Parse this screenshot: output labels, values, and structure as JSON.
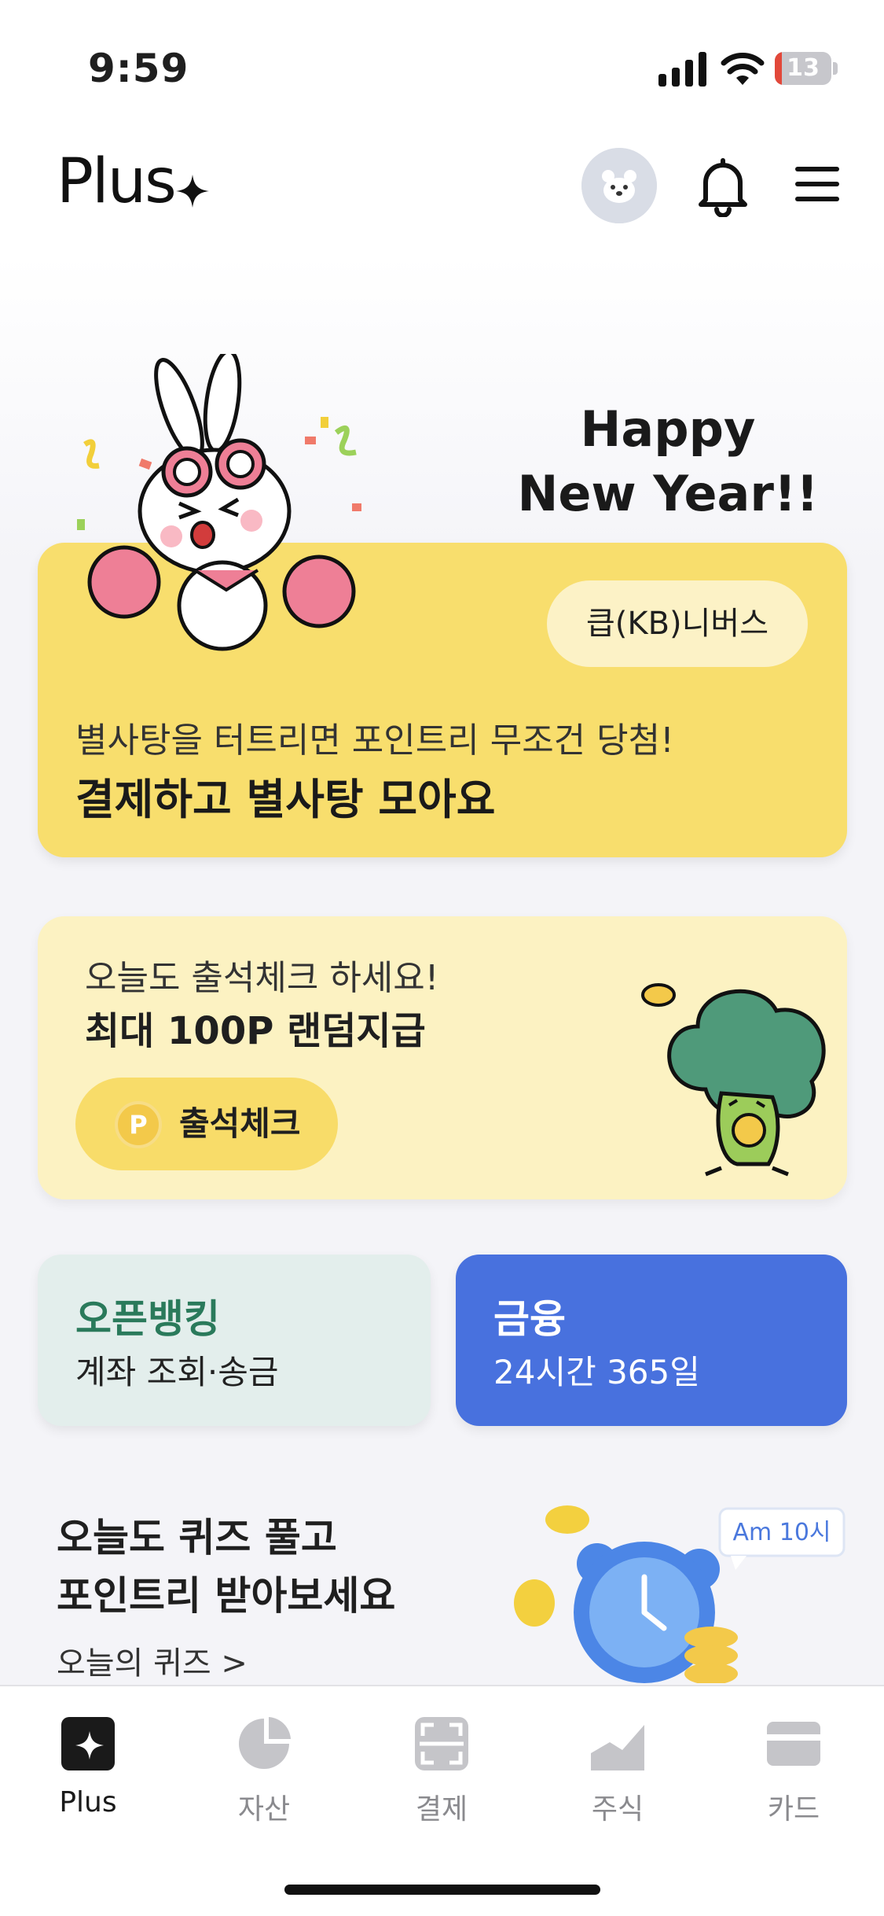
{
  "status_bar": {
    "time": "9:59",
    "battery": "13",
    "battery_level": 0.13
  },
  "header": {
    "logo": "Plus"
  },
  "hero": {
    "greeting_line1": "Happy",
    "greeting_line2": "New Year!!",
    "tag": "큽(KB)니버스",
    "subtitle": "별사탕을 터트리면 포인트리 무조건 당첨!",
    "title": "결제하고 별사탕 모아요"
  },
  "attendance": {
    "subtitle": "오늘도 출석체크 하세요!",
    "title": "최대 100P 랜덤지급",
    "coin": "P",
    "button": "출석체크"
  },
  "tiles": [
    {
      "title": "오픈뱅킹",
      "subtitle": "계좌 조회·송금"
    },
    {
      "title": "금융",
      "subtitle": "24시간 365일"
    }
  ],
  "quiz": {
    "line1": "오늘도 퀴즈 풀고",
    "line2": "포인트리 받아보세요",
    "link": "오늘의 퀴즈 >",
    "bubble": "Am 10시"
  },
  "tabs": [
    {
      "label": "Plus",
      "icon": "plus-icon",
      "active": true
    },
    {
      "label": "자산",
      "icon": "pie-chart-icon"
    },
    {
      "label": "결제",
      "icon": "scan-icon"
    },
    {
      "label": "주식",
      "icon": "stock-chart-icon"
    },
    {
      "label": "카드",
      "icon": "card-icon"
    }
  ],
  "colors": {
    "accent_yellow": "#f8de6d",
    "finance_blue": "#4871de",
    "openbanking_green": "#2a7a5b"
  }
}
